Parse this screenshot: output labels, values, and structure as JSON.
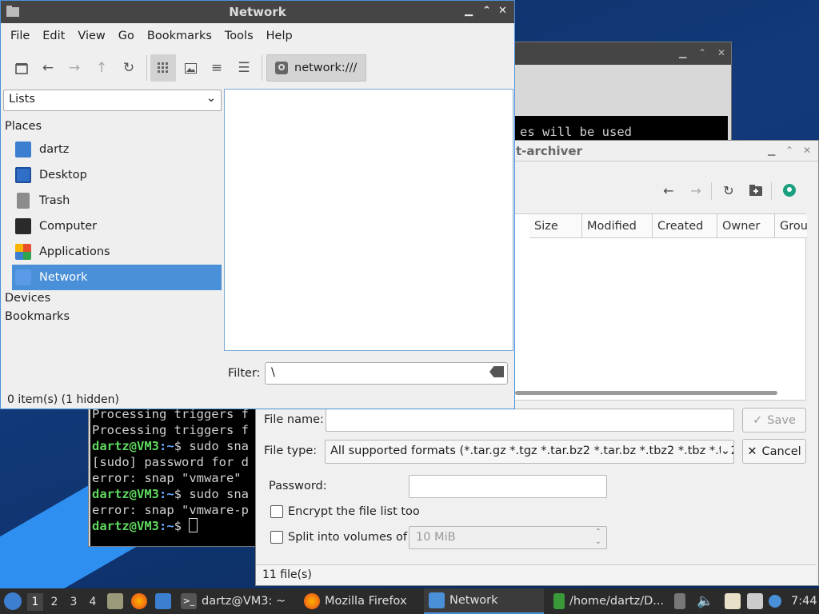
{
  "network_window": {
    "title": "Network",
    "controls": {
      "minimize": "⌃",
      "maximize": "⌃",
      "close": "✕"
    },
    "menu": [
      "File",
      "Edit",
      "View",
      "Go",
      "Bookmarks",
      "Tools",
      "Help"
    ],
    "location": "network:///",
    "side_pane_mode": "Lists",
    "places_heading": "Places",
    "places": [
      {
        "label": "dartz",
        "icon": "home-folder-icon",
        "color": "#3c7fd1"
      },
      {
        "label": "Desktop",
        "icon": "desktop-icon",
        "color": "#2f6fc8"
      },
      {
        "label": "Trash",
        "icon": "trash-icon",
        "color": "#8c8c8c"
      },
      {
        "label": "Computer",
        "icon": "computer-icon",
        "color": "#2a2a2a"
      },
      {
        "label": "Applications",
        "icon": "applications-icon",
        "color": "#e84e2c"
      },
      {
        "label": "Network",
        "icon": "network-icon",
        "color": "#3c7fd1"
      }
    ],
    "selected_place": "Network",
    "devices_heading": "Devices",
    "bookmarks_heading": "Bookmarks",
    "filter_label": "Filter:",
    "filter_value": "\\",
    "status": "0 item(s) (1 hidden)"
  },
  "terminal": {
    "lines": [
      {
        "prompt": "",
        "text": "Processing triggers f"
      },
      {
        "prompt": "",
        "text": "Processing triggers f"
      },
      {
        "prompt": "dartz@VM3",
        "path": ":~",
        "text": "$ sudo sna"
      },
      {
        "prompt": "",
        "text": "[sudo] password for d"
      },
      {
        "prompt": "",
        "text": "error: snap \"vmware\" "
      },
      {
        "prompt": "dartz@VM3",
        "path": ":~",
        "text": "$ sudo sna"
      },
      {
        "prompt": "",
        "text": "error: snap \"vmware-p"
      },
      {
        "prompt": "dartz@VM3",
        "path": ":~",
        "text": "$ "
      }
    ],
    "hidden_line": "es will be used"
  },
  "archiver_dialog": {
    "title_fragment": "t-archiver",
    "columns": [
      "Size",
      "Modified",
      "Created",
      "Owner",
      "Grou"
    ],
    "file_name_label": "File name:",
    "file_name_value": "",
    "save_label": "Save",
    "file_type_label": "File type:",
    "file_type_value": "All supported formats (*.tar.gz *.tgz *.tar.bz2 *.tar.bz *.tbz2 *.tbz *.tb2 *.",
    "cancel_label": "Cancel",
    "password_label": "Password:",
    "encrypt_label": "Encrypt the file list too",
    "split_label": "Split into volumes of",
    "split_value": "10 MiB",
    "status": "11 file(s)"
  },
  "taskbar": {
    "workspaces": [
      "1",
      "2",
      "3",
      "4"
    ],
    "active_workspace": "1",
    "tasks": [
      {
        "label": "dartz@VM3: ~",
        "icon": "terminal-icon"
      },
      {
        "label": "Mozilla Firefox",
        "icon": "firefox-icon"
      },
      {
        "label": "Network",
        "icon": "folder-icon"
      },
      {
        "label": "/home/dartz/D...",
        "icon": "archive-icon"
      }
    ],
    "clock": "7:44"
  }
}
